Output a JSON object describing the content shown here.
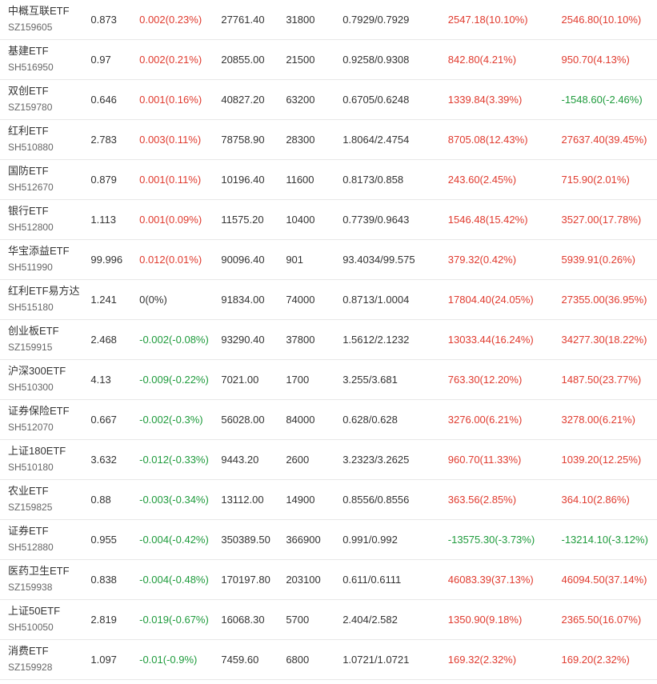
{
  "colors": {
    "up": "#e03a2e",
    "down": "#1e9b3c",
    "flat": "#333333"
  },
  "rows": [
    {
      "name": "中概互联ETF",
      "code": "SZ159605",
      "price": "0.873",
      "change": "0.002(0.23%)",
      "change_dir": "up",
      "c3": "27761.40",
      "c4": "31800",
      "c5": "0.7929/0.7929",
      "c6": "2547.18(10.10%)",
      "c6_dir": "up",
      "c7": "2546.80(10.10%)",
      "c7_dir": "up"
    },
    {
      "name": "基建ETF",
      "code": "SH516950",
      "price": "0.97",
      "change": "0.002(0.21%)",
      "change_dir": "up",
      "c3": "20855.00",
      "c4": "21500",
      "c5": "0.9258/0.9308",
      "c6": "842.80(4.21%)",
      "c6_dir": "up",
      "c7": "950.70(4.13%)",
      "c7_dir": "up"
    },
    {
      "name": "双创ETF",
      "code": "SZ159780",
      "price": "0.646",
      "change": "0.001(0.16%)",
      "change_dir": "up",
      "c3": "40827.20",
      "c4": "63200",
      "c5": "0.6705/0.6248",
      "c6": "1339.84(3.39%)",
      "c6_dir": "up",
      "c7": "-1548.60(-2.46%)",
      "c7_dir": "down"
    },
    {
      "name": "红利ETF",
      "code": "SH510880",
      "price": "2.783",
      "change": "0.003(0.11%)",
      "change_dir": "up",
      "c3": "78758.90",
      "c4": "28300",
      "c5": "1.8064/2.4754",
      "c6": "8705.08(12.43%)",
      "c6_dir": "up",
      "c7": "27637.40(39.45%)",
      "c7_dir": "up"
    },
    {
      "name": "国防ETF",
      "code": "SH512670",
      "price": "0.879",
      "change": "0.001(0.11%)",
      "change_dir": "up",
      "c3": "10196.40",
      "c4": "11600",
      "c5": "0.8173/0.858",
      "c6": "243.60(2.45%)",
      "c6_dir": "up",
      "c7": "715.90(2.01%)",
      "c7_dir": "up"
    },
    {
      "name": "银行ETF",
      "code": "SH512800",
      "price": "1.113",
      "change": "0.001(0.09%)",
      "change_dir": "up",
      "c3": "11575.20",
      "c4": "10400",
      "c5": "0.7739/0.9643",
      "c6": "1546.48(15.42%)",
      "c6_dir": "up",
      "c7": "3527.00(17.78%)",
      "c7_dir": "up"
    },
    {
      "name": "华宝添益ETF",
      "code": "SH511990",
      "price": "99.996",
      "change": "0.012(0.01%)",
      "change_dir": "up",
      "c3": "90096.40",
      "c4": "901",
      "c5": "93.4034/99.575",
      "c6": "379.32(0.42%)",
      "c6_dir": "up",
      "c7": "5939.91(0.26%)",
      "c7_dir": "up"
    },
    {
      "name": "红利ETF易方达",
      "code": "SH515180",
      "price": "1.241",
      "change": "0(0%)",
      "change_dir": "flat",
      "c3": "91834.00",
      "c4": "74000",
      "c5": "0.8713/1.0004",
      "c6": "17804.40(24.05%)",
      "c6_dir": "up",
      "c7": "27355.00(36.95%)",
      "c7_dir": "up"
    },
    {
      "name": "创业板ETF",
      "code": "SZ159915",
      "price": "2.468",
      "change": "-0.002(-0.08%)",
      "change_dir": "down",
      "c3": "93290.40",
      "c4": "37800",
      "c5": "1.5612/2.1232",
      "c6": "13033.44(16.24%)",
      "c6_dir": "up",
      "c7": "34277.30(18.22%)",
      "c7_dir": "up"
    },
    {
      "name": "沪深300ETF",
      "code": "SH510300",
      "price": "4.13",
      "change": "-0.009(-0.22%)",
      "change_dir": "down",
      "c3": "7021.00",
      "c4": "1700",
      "c5": "3.255/3.681",
      "c6": "763.30(12.20%)",
      "c6_dir": "up",
      "c7": "1487.50(23.77%)",
      "c7_dir": "up"
    },
    {
      "name": "证券保险ETF",
      "code": "SH512070",
      "price": "0.667",
      "change": "-0.002(-0.3%)",
      "change_dir": "down",
      "c3": "56028.00",
      "c4": "84000",
      "c5": "0.628/0.628",
      "c6": "3276.00(6.21%)",
      "c6_dir": "up",
      "c7": "3278.00(6.21%)",
      "c7_dir": "up"
    },
    {
      "name": "上证180ETF",
      "code": "SH510180",
      "price": "3.632",
      "change": "-0.012(-0.33%)",
      "change_dir": "down",
      "c3": "9443.20",
      "c4": "2600",
      "c5": "3.2323/3.2625",
      "c6": "960.70(11.33%)",
      "c6_dir": "up",
      "c7": "1039.20(12.25%)",
      "c7_dir": "up"
    },
    {
      "name": "农业ETF",
      "code": "SZ159825",
      "price": "0.88",
      "change": "-0.003(-0.34%)",
      "change_dir": "down",
      "c3": "13112.00",
      "c4": "14900",
      "c5": "0.8556/0.8556",
      "c6": "363.56(2.85%)",
      "c6_dir": "up",
      "c7": "364.10(2.86%)",
      "c7_dir": "up"
    },
    {
      "name": "证券ETF",
      "code": "SH512880",
      "price": "0.955",
      "change": "-0.004(-0.42%)",
      "change_dir": "down",
      "c3": "350389.50",
      "c4": "366900",
      "c5": "0.991/0.992",
      "c6": "-13575.30(-3.73%)",
      "c6_dir": "down",
      "c7": "-13214.10(-3.12%)",
      "c7_dir": "down"
    },
    {
      "name": "医药卫生ETF",
      "code": "SZ159938",
      "price": "0.838",
      "change": "-0.004(-0.48%)",
      "change_dir": "down",
      "c3": "170197.80",
      "c4": "203100",
      "c5": "0.611/0.6111",
      "c6": "46083.39(37.13%)",
      "c6_dir": "up",
      "c7": "46094.50(37.14%)",
      "c7_dir": "up"
    },
    {
      "name": "上证50ETF",
      "code": "SH510050",
      "price": "2.819",
      "change": "-0.019(-0.67%)",
      "change_dir": "down",
      "c3": "16068.30",
      "c4": "5700",
      "c5": "2.404/2.582",
      "c6": "1350.90(9.18%)",
      "c6_dir": "up",
      "c7": "2365.50(16.07%)",
      "c7_dir": "up"
    },
    {
      "name": "消费ETF",
      "code": "SZ159928",
      "price": "1.097",
      "change": "-0.01(-0.9%)",
      "change_dir": "down",
      "c3": "7459.60",
      "c4": "6800",
      "c5": "1.0721/1.0721",
      "c6": "169.32(2.32%)",
      "c6_dir": "up",
      "c7": "169.20(2.32%)",
      "c7_dir": "up"
    }
  ]
}
